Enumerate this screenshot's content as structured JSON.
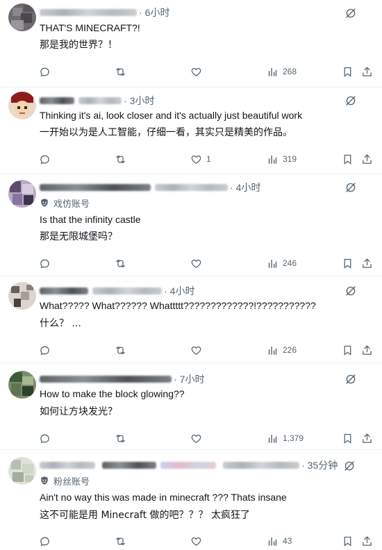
{
  "replies": [
    {
      "time": "6小时",
      "text": "THAT'S MINECRAFT?!",
      "translation": "那是我的世界？！",
      "likes": "",
      "views": "268"
    },
    {
      "time": "3小时",
      "text": "Thinking it's ai, look closer and it's actually just beautiful work",
      "translation": "一开始以为是人工智能，仔细一看，其实只是精美的作品。",
      "likes": "1",
      "views": "319"
    },
    {
      "time": "4小时",
      "badge": "戏仿账号",
      "text": "Is that the infinity castle",
      "translation": "那是无限城堡吗？",
      "likes": "",
      "views": "246"
    },
    {
      "time": "4小时",
      "text": "What????? What?????? Whattttt?????????????!???????????",
      "translation": "什么？ ...",
      "likes": "",
      "views": "226"
    },
    {
      "time": "7小时",
      "text": "How to make the block glowing??",
      "translation": "如何让方块发光？",
      "likes": "",
      "views": "1,379"
    },
    {
      "time": "35分钟",
      "badge": "粉丝账号",
      "text": "Ain't no way this was made in minecraft ??? Thats insane",
      "translation": "这不可能是用 Minecraft 做的吧？？？ 太疯狂了",
      "likes": "",
      "views": "43"
    }
  ],
  "icons": {
    "reply": "reply-icon",
    "retweet": "retweet-icon",
    "like": "like-icon",
    "views": "views-icon",
    "bookmark": "bookmark-icon",
    "share": "share-icon",
    "grok": "grok-icon",
    "badge": "badge-icon"
  },
  "colors": {
    "text": "#0f1419",
    "secondary": "#536471",
    "divider": "#eff3f4",
    "background": "#ffffff"
  }
}
